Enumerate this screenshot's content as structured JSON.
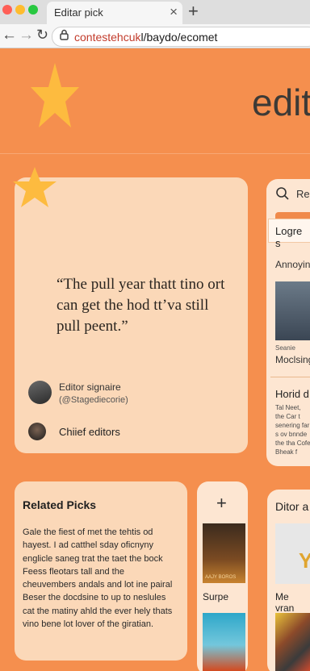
{
  "browser": {
    "tab_title": "Editar pick",
    "tab_close": "×",
    "new_tab": "+",
    "url_highlight": "contestehcuk",
    "url_rest": "l/baydo/ecomet",
    "lock_glyph": "🔒"
  },
  "hero": {
    "title": "edit",
    "star_color": "#fdbb3f"
  },
  "quote_card": {
    "quote": "“The pull year thatt tino ort can get the hod tt’va still pull peent.”",
    "signature_label": "Editor signaire",
    "signature_handle": "(@Stagediecorie)",
    "chief_label": "Chiief editors"
  },
  "side_panel": {
    "search_label": "Re",
    "login_label": "Logre s",
    "annoy_label": "Annoyin",
    "caption_small": "Seanie",
    "caption": "Moclsing",
    "section_title": "Horid d",
    "paragraph": "Tal Neet, the Car t senering far s ov bnnde the tha Cofe Bheak f"
  },
  "related": {
    "title": "Related Picks",
    "body": "Gale the fiest of met the tehtis od hayest. I ad catthel sday oficnyny englicle saneg trat the taet the bock Feess fleotars tall and the cheuvembers andals and lot ine pairal Beser the docdsine to up to neslules cat the matiny ahld the ever hely thats vino bene lot lover of the giratian."
  },
  "middle_column": {
    "plus": "+",
    "poster_text": "AAJY BOROS",
    "label": "Surpe"
  },
  "right_column": {
    "title": "Ditor a",
    "label": "Me vran",
    "panel_letter": "Y"
  },
  "colors": {
    "page_bg": "#f58f4e",
    "card_bg": "#fbd8b8",
    "accent": "#f08a4b",
    "star": "#fdbb3f"
  }
}
